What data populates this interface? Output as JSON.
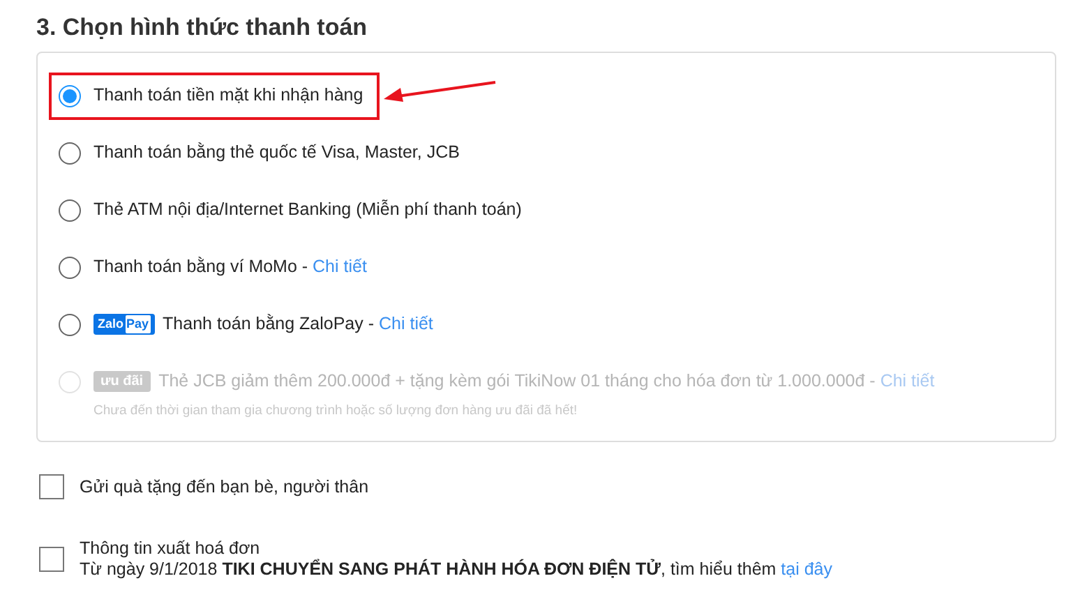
{
  "section_title": "3. Chọn hình thức thanh toán",
  "payment_options": [
    {
      "kind": "plain",
      "label": "Thanh toán tiền mặt khi nhận hàng",
      "selected": true,
      "disabled": false,
      "highlighted": true
    },
    {
      "kind": "plain",
      "label": "Thanh toán bằng thẻ quốc tế Visa, Master, JCB",
      "selected": false,
      "disabled": false,
      "highlighted": false
    },
    {
      "kind": "plain",
      "label": "Thẻ ATM nội địa/Internet Banking (Miễn phí thanh toán)",
      "selected": false,
      "disabled": false,
      "highlighted": false
    },
    {
      "kind": "link",
      "label": "Thanh toán bằng ví MoMo - ",
      "link": "Chi tiết",
      "selected": false,
      "disabled": false,
      "highlighted": false
    },
    {
      "kind": "wallet_badge",
      "badge": [
        "Zalo",
        "Pay"
      ],
      "label": "Thanh toán bằng ZaloPay - ",
      "link": "Chi tiết",
      "selected": false,
      "disabled": false,
      "highlighted": false
    },
    {
      "kind": "promo",
      "badge": [
        "ưu đãi"
      ],
      "label": "Thẻ JCB giảm thêm 200.000đ + tặng kèm gói TikiNow 01 tháng cho hóa đơn từ 1.000.000đ - ",
      "link": "Chi tiết",
      "note": "Chưa đến thời gian tham gia chương trình hoặc số lượng đơn hàng ưu đãi đã hết!",
      "selected": false,
      "disabled": true,
      "highlighted": false
    }
  ],
  "extras": [
    {
      "label": "Gửi quà tặng đến bạn bè, người thân",
      "checked": false
    },
    {
      "label": "Thông tin xuất hoá đơn",
      "detail": "Từ ngày 9/1/2018 **TIKI CHUYỂN SANG PHÁT HÀNH HÓA ĐƠN ĐIỆN TỬ**, tìm hiểu thêm ",
      "link": "tại đây",
      "checked": false
    }
  ]
}
